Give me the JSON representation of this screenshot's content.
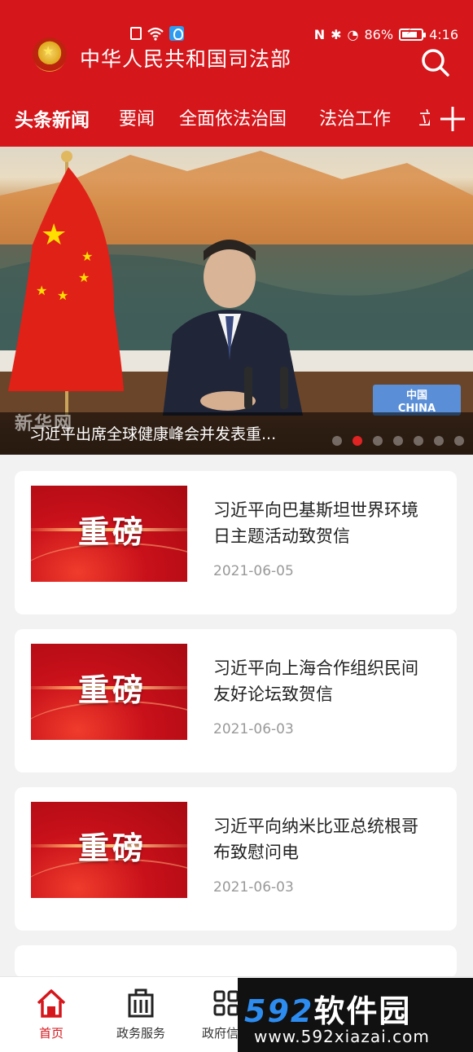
{
  "status_bar": {
    "battery_percent": "86%",
    "time": "4:16"
  },
  "header": {
    "title": "中华人民共和国司法部",
    "tabs": [
      {
        "label": "头条新闻",
        "active": true
      },
      {
        "label": "要闻",
        "active": false
      },
      {
        "label": "全面依法治国",
        "active": false
      },
      {
        "label": "法治工作",
        "active": false
      }
    ],
    "tab_partial": "立"
  },
  "banner": {
    "caption": "习近平出席全球健康峰会并发表重...",
    "watermark": "新华网",
    "nameplate_cn": "中国",
    "nameplate_en": "CHINA",
    "slide_count": 7,
    "active_slide": 2
  },
  "news": [
    {
      "thumb_label": "重磅",
      "title": "习近平向巴基斯坦世界环境日主题活动致贺信",
      "date": "2021-06-05"
    },
    {
      "thumb_label": "重磅",
      "title": "习近平向上海合作组织民间友好论坛致贺信",
      "date": "2021-06-03"
    },
    {
      "thumb_label": "重磅",
      "title": "习近平向纳米比亚总统根哥布致慰问电",
      "date": "2021-06-03"
    }
  ],
  "bottom_nav": {
    "items": [
      {
        "label": "首页",
        "icon": "home-icon",
        "active": true
      },
      {
        "label": "政务服务",
        "icon": "building-icon",
        "active": false
      },
      {
        "label": "政府信息",
        "icon": "grid-icon",
        "active": false
      }
    ]
  },
  "promo": {
    "logo_num": "592",
    "logo_cn": "软件园",
    "url": "www.592xiazai.com"
  },
  "colors": {
    "brand_red": "#d5161b",
    "active_dot": "#e02323"
  }
}
